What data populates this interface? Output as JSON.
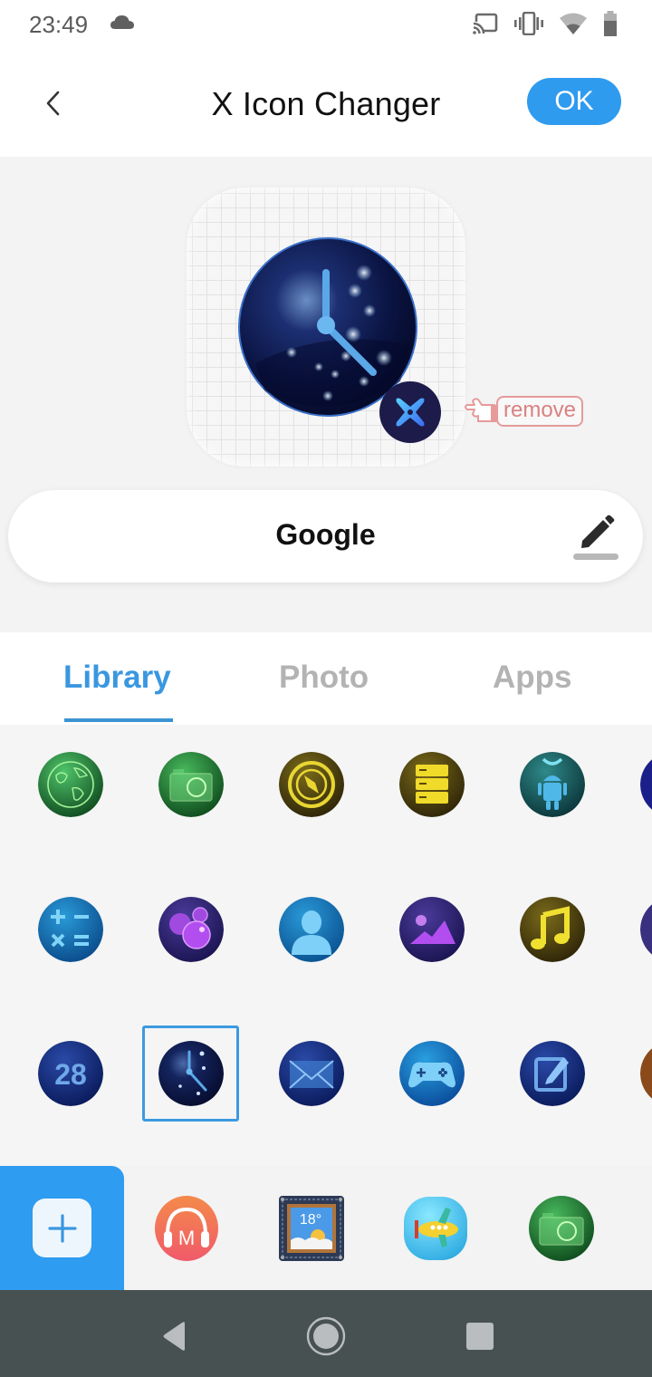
{
  "status_bar": {
    "time": "23:49",
    "icons": [
      "cloud-icon",
      "cast-icon",
      "vibrate-icon",
      "wifi-icon",
      "battery-icon"
    ]
  },
  "header": {
    "title": "X Icon Changer",
    "back_icon": "chevron-left-icon",
    "ok_label": "OK"
  },
  "preview": {
    "icon": "clock-icon",
    "badge_icon": "x-icon-changer-logo",
    "remove_label": "remove",
    "remove_hint_icon": "pointing-hand-icon"
  },
  "name_field": {
    "value": "Google",
    "edit_icon": "pencil-icon"
  },
  "tabs": [
    {
      "label": "Library",
      "active": true
    },
    {
      "label": "Photo",
      "active": false
    },
    {
      "label": "Apps",
      "active": false
    }
  ],
  "library": {
    "rows": [
      [
        "globe-icon",
        "camera-icon",
        "compass-icon",
        "storage-icon",
        "android-icon",
        "partial-blue-icon"
      ],
      [
        "calculator-icon",
        "bubbles-icon",
        "contacts-icon",
        "gallery-icon",
        "music-icon",
        "partial-purple-icon"
      ],
      [
        "calendar-28-icon",
        "clock-icon",
        "mail-icon",
        "gamepad-icon",
        "notes-icon",
        "partial-orange-icon"
      ]
    ],
    "selected": "clock-icon",
    "calendar_day": "28"
  },
  "dock": {
    "add_icon": "plus-icon",
    "items": [
      "music-m-icon",
      "weather-icon",
      "airplane-game-icon",
      "camera-icon"
    ],
    "music_letter": "M",
    "weather_temp": "18°"
  },
  "nav_bar": {
    "items": [
      "back-triangle-icon",
      "home-circle-icon",
      "recents-square-icon"
    ]
  },
  "colors": {
    "accent": "#2f9bef",
    "tab_active": "#3a97e0",
    "tab_inactive": "#b3b3b3",
    "remove_hint": "#d98282",
    "nav_bar": "#485152"
  }
}
